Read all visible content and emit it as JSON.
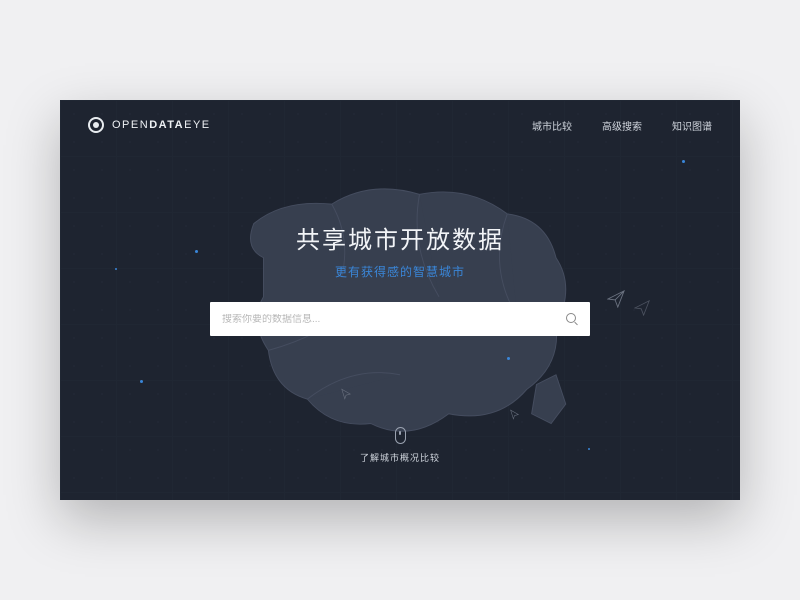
{
  "brand": {
    "name_light1": "OPEN",
    "name_bold": "DATA",
    "name_light2": "EYE"
  },
  "nav": {
    "items": [
      "城市比较",
      "高级搜索",
      "知识图谱"
    ]
  },
  "hero": {
    "title": "共享城市开放数据",
    "subtitle": "更有获得感的智慧城市"
  },
  "search": {
    "placeholder": "搜索你要的数据信息..."
  },
  "scroll": {
    "hint": "了解城市概况比较"
  }
}
